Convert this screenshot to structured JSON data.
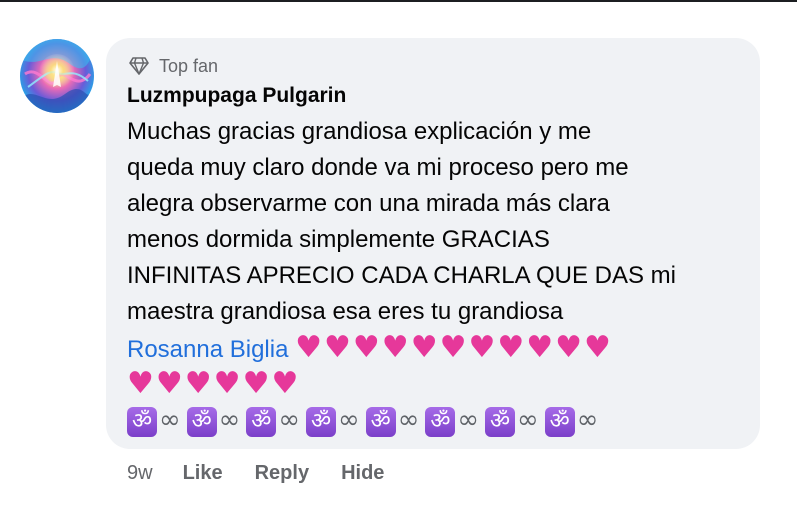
{
  "comment": {
    "badge": "Top fan",
    "author": "Luzmpupaga Pulgarin",
    "lines": [
      "Muchas gracias grandiosa explicación y me",
      "queda muy claro donde va mi proceso pero me",
      "alegra observarme con una mirada más clara",
      "menos dormida simplemente GRACIAS",
      "INFINITAS APRECIO CADA CHARLA QUE DAS mi",
      "maestra grandiosa esa eres tu grandiosa"
    ],
    "mention": "Rosanna Biglia",
    "hearts_line1": "♥♥♥♥♥♥♥♥♥♥♥",
    "hearts_line2": "♥♥♥♥♥♥",
    "om_symbol": "ॐ",
    "infinity_symbol": "∞"
  },
  "actions": {
    "time": "9w",
    "like": "Like",
    "reply": "Reply",
    "hide": "Hide"
  },
  "colors": {
    "bubble": "#f0f2f5",
    "mention": "#216fdb",
    "heart": "#e6389a",
    "om_tile": "#8b4fd6",
    "secondary_text": "#65676b"
  },
  "icons": {
    "badge_icon": "diamond-icon",
    "heart_icon": "pink-heart-icon",
    "om_icon": "om-symbol-icon",
    "infinity_icon": "infinity-icon"
  }
}
